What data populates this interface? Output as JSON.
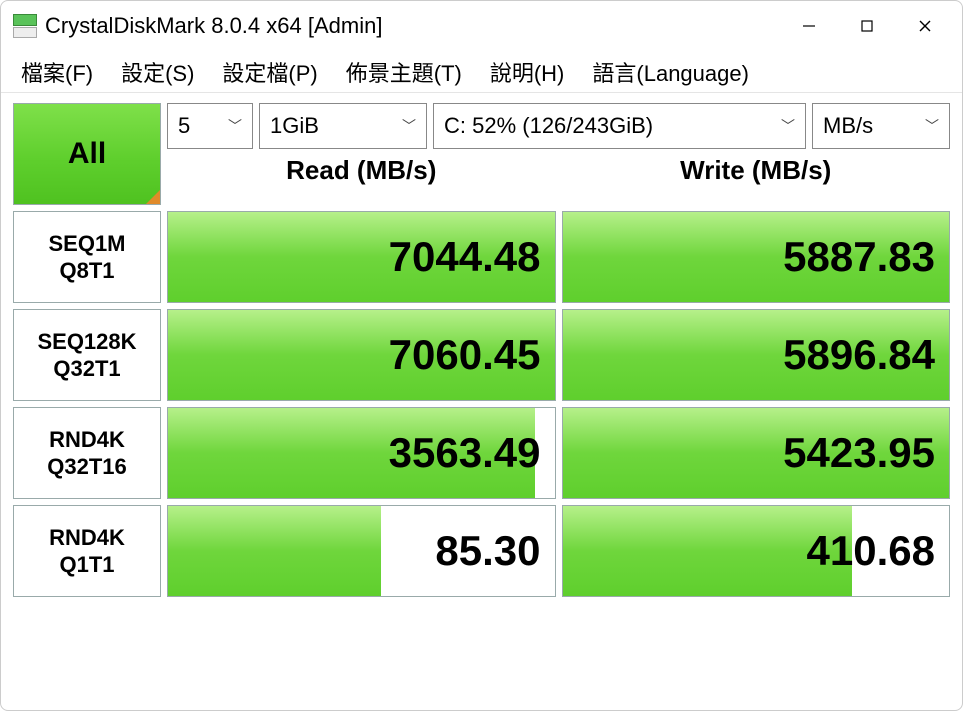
{
  "window": {
    "title": "CrystalDiskMark 8.0.4 x64 [Admin]"
  },
  "menu": {
    "file": "檔案(F)",
    "settings": "設定(S)",
    "profile": "設定檔(P)",
    "theme": "佈景主題(T)",
    "help": "說明(H)",
    "language": "語言(Language)"
  },
  "controls": {
    "all_label": "All",
    "loops": "5",
    "size": "1GiB",
    "drive": "C: 52% (126/243GiB)",
    "unit": "MB/s"
  },
  "columns": {
    "read": "Read (MB/s)",
    "write": "Write (MB/s)"
  },
  "tests": [
    {
      "label1": "SEQ1M",
      "label2": "Q8T1",
      "read": "7044.48",
      "read_pct": 100,
      "write": "5887.83",
      "write_pct": 100
    },
    {
      "label1": "SEQ128K",
      "label2": "Q32T1",
      "read": "7060.45",
      "read_pct": 100,
      "write": "5896.84",
      "write_pct": 100
    },
    {
      "label1": "RND4K",
      "label2": "Q32T16",
      "read": "3563.49",
      "read_pct": 95,
      "write": "5423.95",
      "write_pct": 100
    },
    {
      "label1": "RND4K",
      "label2": "Q1T1",
      "read": "85.30",
      "read_pct": 55,
      "write": "410.68",
      "write_pct": 75
    }
  ]
}
